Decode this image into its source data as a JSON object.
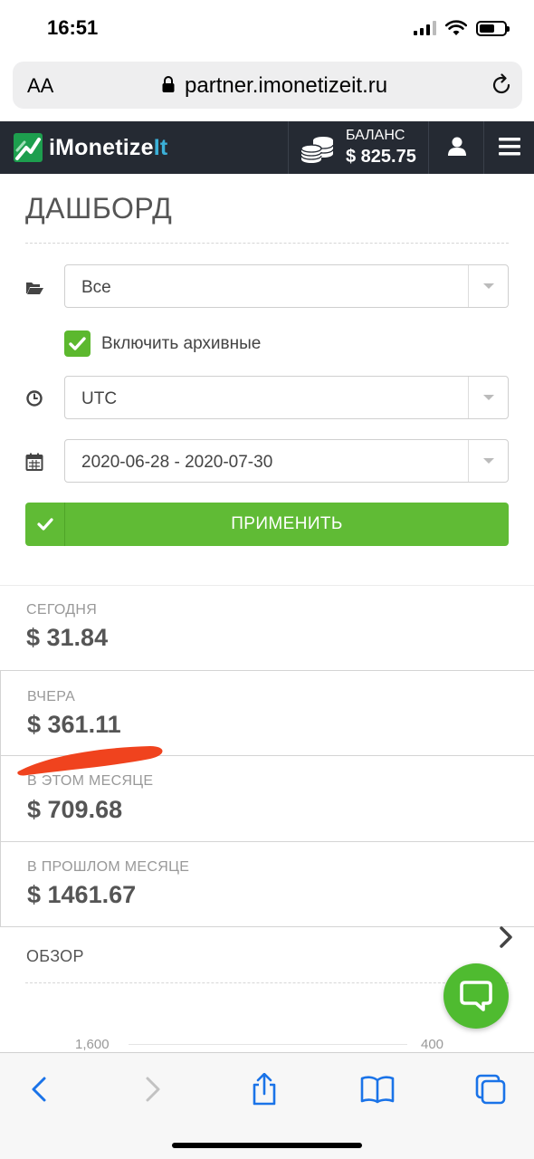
{
  "status_bar": {
    "time": "16:51"
  },
  "browser": {
    "text_size_label": "AA",
    "url": "partner.imonetizeit.ru"
  },
  "header": {
    "logo_text_main": "iMonetize",
    "logo_text_accent": "It",
    "balance_label": "БАЛАНС",
    "balance_value": "$ 825.75"
  },
  "dashboard": {
    "title": "ДАШБОРД",
    "filters": {
      "source": "Все",
      "include_archived_label": "Включить архивные",
      "include_archived_checked": true,
      "timezone": "UTC",
      "date_range": "2020-06-28 - 2020-07-30"
    },
    "apply_label": "ПРИМЕНИТЬ"
  },
  "stats": [
    {
      "label": "СЕГОДНЯ",
      "value": "$ 31.84"
    },
    {
      "label": "ВЧЕРА",
      "value": "$ 361.11"
    },
    {
      "label": "В ЭТОМ МЕСЯЦЕ",
      "value": "$ 709.68"
    },
    {
      "label": "В ПРОШЛОМ МЕСЯЦЕ",
      "value": "$ 1461.67"
    }
  ],
  "overview": {
    "label": "ОБЗОР",
    "axis_left_tick": "1,600",
    "axis_right_tick": "400"
  },
  "colors": {
    "header_bg": "#252a33",
    "accent_green": "#60bb35",
    "logo_accent": "#3bb0d8",
    "redaction": "#f0431e"
  }
}
